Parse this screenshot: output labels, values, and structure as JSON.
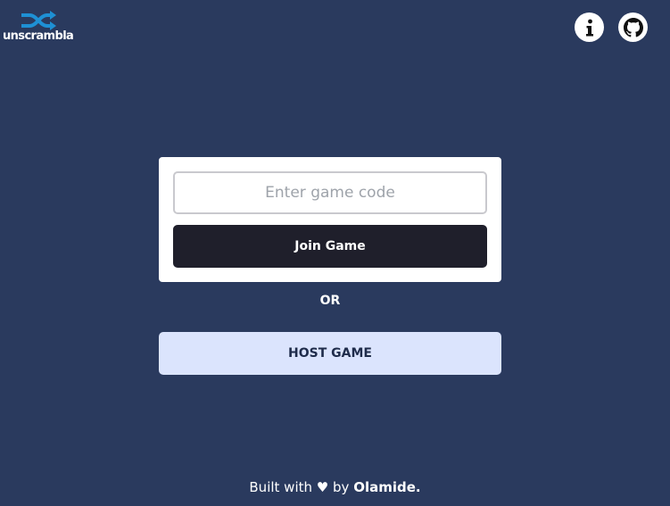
{
  "brand": {
    "name": "unscrambla",
    "logo_icon": "shuffle-icon",
    "logo_color": "#1e90d4"
  },
  "header": {
    "info_icon": "info-icon",
    "github_icon": "github-icon"
  },
  "join_form": {
    "code_placeholder": "Enter game code",
    "code_value": "",
    "join_label": "Join Game"
  },
  "divider": {
    "label": "OR"
  },
  "host": {
    "label": "HOST GAME"
  },
  "footer": {
    "prefix": "Built with",
    "heart": "♥",
    "by": "by",
    "author": "Olamide."
  },
  "colors": {
    "background": "#2a3a5e",
    "join_button": "#1f1f2b",
    "host_button": "#dbe4fd"
  }
}
